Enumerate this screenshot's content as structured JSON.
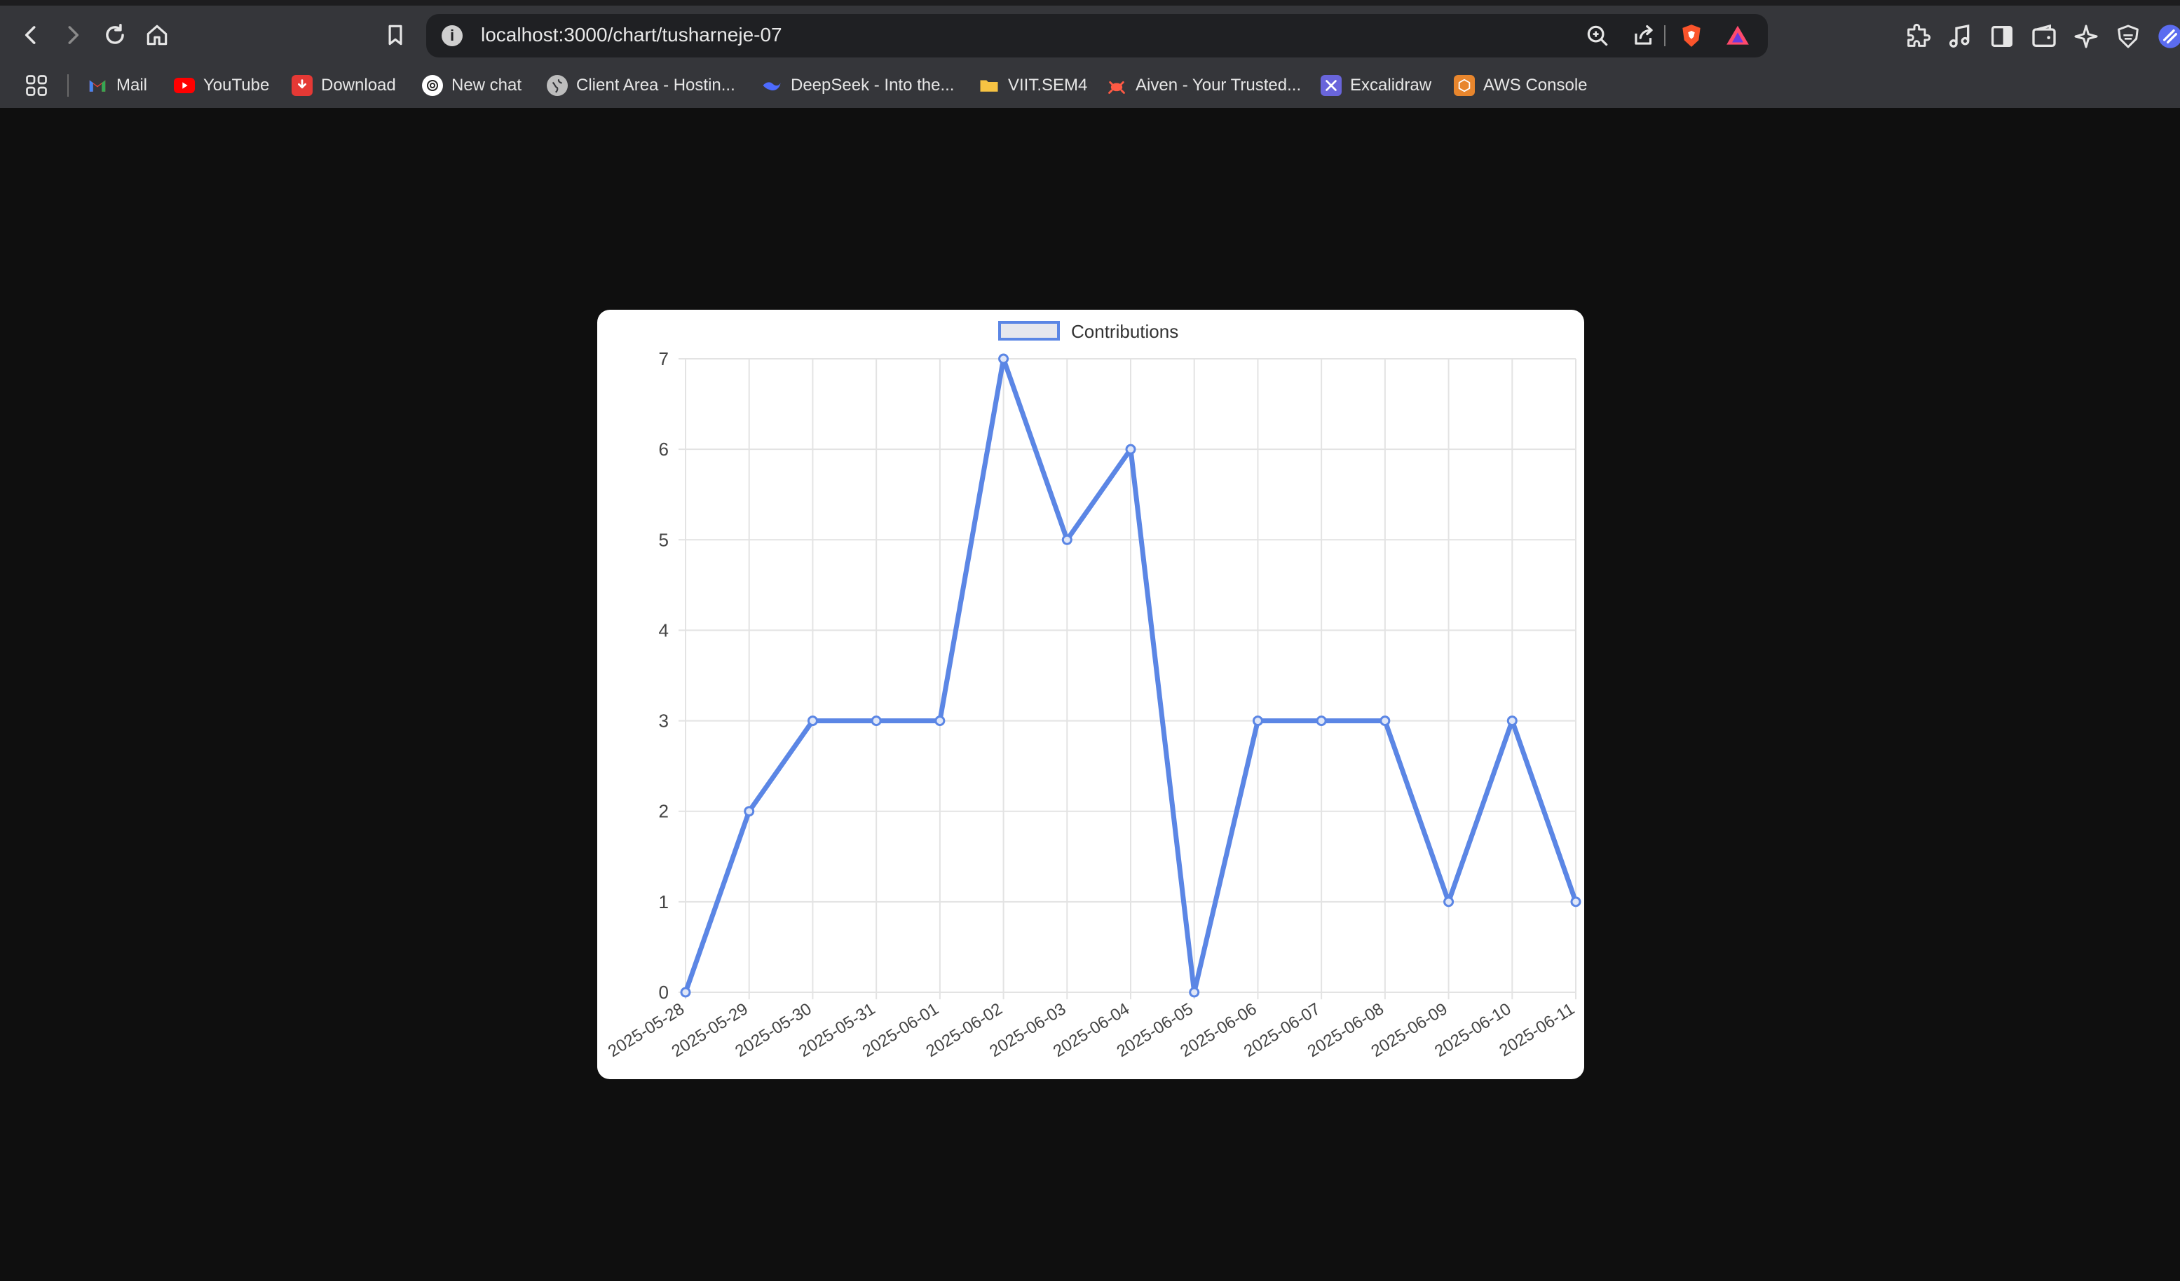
{
  "browser": {
    "url": "localhost:3000/chart/tusharneje-07",
    "bookmarks": [
      {
        "label": "Mail",
        "icon": "gmail-icon",
        "color": "#ea4335"
      },
      {
        "label": "YouTube",
        "icon": "youtube-icon",
        "color": "#ff0000"
      },
      {
        "label": "Download",
        "icon": "download-icon",
        "color": "#e53935"
      },
      {
        "label": "New chat",
        "icon": "openai-icon",
        "color": "#ffffff"
      },
      {
        "label": "Client Area - Hostin...",
        "icon": "globe-icon",
        "color": "#bdbdbd"
      },
      {
        "label": "DeepSeek - Into the...",
        "icon": "deepseek-icon",
        "color": "#4d6bfe"
      },
      {
        "label": "VIIT.SEM4",
        "icon": "folder-icon",
        "color": "#f6c343"
      },
      {
        "label": "Aiven - Your Trusted...",
        "icon": "aiven-icon",
        "color": "#ff5a44"
      },
      {
        "label": "Excalidraw",
        "icon": "excalidraw-icon",
        "color": "#6965db"
      },
      {
        "label": "AWS Console",
        "icon": "aws-icon",
        "color": "#e8862d"
      }
    ]
  },
  "chart_data": {
    "type": "line",
    "legend": {
      "label": "Contributions",
      "position": "top"
    },
    "categories": [
      "2025-05-28",
      "2025-05-29",
      "2025-05-30",
      "2025-05-31",
      "2025-06-01",
      "2025-06-02",
      "2025-06-03",
      "2025-06-04",
      "2025-06-05",
      "2025-06-06",
      "2025-06-07",
      "2025-06-08",
      "2025-06-09",
      "2025-06-10",
      "2025-06-11"
    ],
    "series": [
      {
        "name": "Contributions",
        "values": [
          0,
          2,
          3,
          3,
          3,
          7,
          5,
          6,
          0,
          3,
          3,
          3,
          1,
          3,
          1
        ],
        "color": "#5b86e5"
      }
    ],
    "yticks": [
      0,
      1,
      2,
      3,
      4,
      5,
      6,
      7
    ],
    "ylim": [
      0,
      7
    ],
    "grid": true
  }
}
